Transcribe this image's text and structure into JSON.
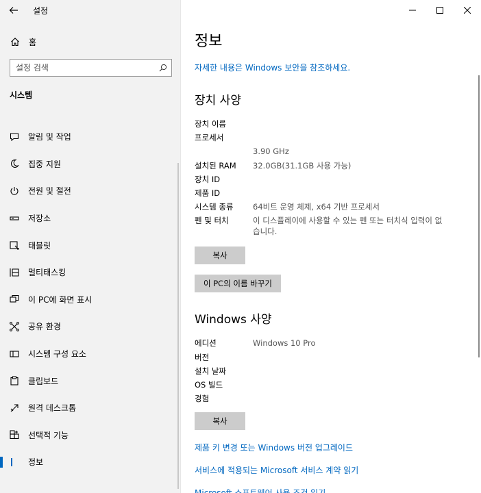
{
  "app": {
    "title": "설정"
  },
  "sidebar": {
    "home_label": "홈",
    "search_placeholder": "설정 검색",
    "section_title": "시스템",
    "items": [
      {
        "label": "알림 및 작업",
        "icon": "notification-icon"
      },
      {
        "label": "집중 지원",
        "icon": "focus-moon-icon"
      },
      {
        "label": "전원 및 절전",
        "icon": "power-icon"
      },
      {
        "label": "저장소",
        "icon": "storage-icon"
      },
      {
        "label": "태블릿",
        "icon": "tablet-icon"
      },
      {
        "label": "멀티태스킹",
        "icon": "multitasking-icon"
      },
      {
        "label": "이 PC에 화면 표시",
        "icon": "project-icon"
      },
      {
        "label": "공유 환경",
        "icon": "shared-experiences-icon"
      },
      {
        "label": "시스템 구성 요소",
        "icon": "components-icon"
      },
      {
        "label": "클립보드",
        "icon": "clipboard-icon"
      },
      {
        "label": "원격 데스크톱",
        "icon": "remote-desktop-icon"
      },
      {
        "label": "선택적 기능",
        "icon": "optional-features-icon"
      },
      {
        "label": "정보",
        "icon": "info-icon",
        "selected": true
      }
    ]
  },
  "main": {
    "title": "정보",
    "security_link": "자세한 내용은 Windows 보안을 참조하세요.",
    "device_specs": {
      "heading": "장치 사양",
      "rows": [
        {
          "key": "장치 이름",
          "value": ""
        },
        {
          "key": "프로세서",
          "value": ""
        },
        {
          "key": "",
          "value": "3.90 GHz"
        },
        {
          "key": "설치된 RAM",
          "value": "32.0GB(31.1GB 사용 가능)"
        },
        {
          "key": "장치 ID",
          "value": ""
        },
        {
          "key": "제품 ID",
          "value": ""
        },
        {
          "key": "시스템 종류",
          "value": "64비트 운영 체제, x64 기반 프로세서"
        },
        {
          "key": "펜 및 터치",
          "value": "이 디스플레이에 사용할 수 있는 펜 또는 터치식 입력이 없습니다."
        }
      ],
      "copy_button": "복사",
      "rename_button": "이 PC의 이름 바꾸기"
    },
    "windows_specs": {
      "heading": "Windows 사양",
      "rows": [
        {
          "key": "에디션",
          "value": "Windows 10 Pro"
        },
        {
          "key": "버전",
          "value": ""
        },
        {
          "key": "설치 날짜",
          "value": ""
        },
        {
          "key": "OS 빌드",
          "value": ""
        },
        {
          "key": "경험",
          "value": ""
        }
      ],
      "copy_button": "복사"
    },
    "links": [
      "제품 키 변경 또는 Windows 버전 업그레이드",
      "서비스에 적용되는 Microsoft 서비스 계약 읽기",
      "Microsoft 소프트웨어 사용 조건 읽기"
    ]
  },
  "colors": {
    "accent": "#0067c0",
    "sidebar_bg": "#f2f2f2",
    "button_bg": "#cccccc"
  }
}
